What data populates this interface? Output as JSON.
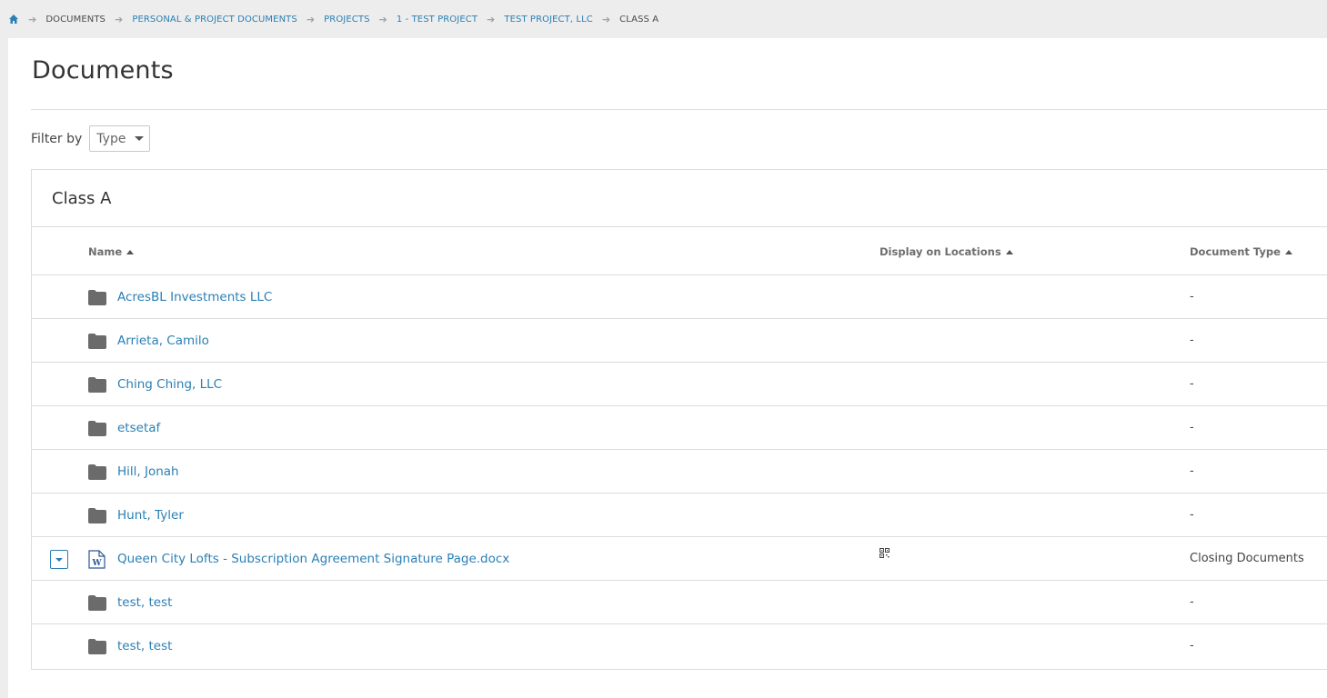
{
  "breadcrumb": {
    "home_icon": "home-icon",
    "separator_icon": "arrow-right-icon",
    "items": [
      {
        "label": "Documents",
        "link": false
      },
      {
        "label": "Personal & Project Documents",
        "link": true
      },
      {
        "label": "Projects",
        "link": true
      },
      {
        "label": "1 - Test Project",
        "link": true
      },
      {
        "label": "Test Project, LLC",
        "link": true
      },
      {
        "label": "Class A",
        "link": false
      }
    ]
  },
  "page": {
    "title": "Documents"
  },
  "filter": {
    "label": "Filter by",
    "type_select": "Type"
  },
  "card": {
    "title": "Class A",
    "columns": {
      "name": "Name",
      "display_on_locations": "Display on Locations",
      "document_type": "Document Type"
    },
    "rows": [
      {
        "icon": "folder-icon",
        "name": "AcresBL Investments LLC",
        "type": "-"
      },
      {
        "icon": "folder-icon",
        "name": "Arrieta, Camilo",
        "type": "-"
      },
      {
        "icon": "folder-icon",
        "name": "Ching Ching, LLC",
        "type": "-"
      },
      {
        "icon": "folder-icon",
        "name": "etsetaf",
        "type": "-"
      },
      {
        "icon": "folder-icon",
        "name": "Hill, Jonah",
        "type": "-"
      },
      {
        "icon": "folder-icon",
        "name": "Hunt, Tyler",
        "type": "-"
      },
      {
        "icon": "word-document-icon",
        "name": "Queen City Lofts - Subscription Agreement Signature Page.docx",
        "type": "Closing Documents",
        "has_actions": true,
        "location_icon": "qr-code-icon"
      },
      {
        "icon": "folder-icon",
        "name": "test, test",
        "type": "-"
      },
      {
        "icon": "folder-icon",
        "name": "test, test",
        "type": "-"
      }
    ]
  },
  "colors": {
    "link": "#2a7fb4",
    "folder": "#6b6b6b",
    "background": "#ededed",
    "word_blue": "#2b579a"
  }
}
